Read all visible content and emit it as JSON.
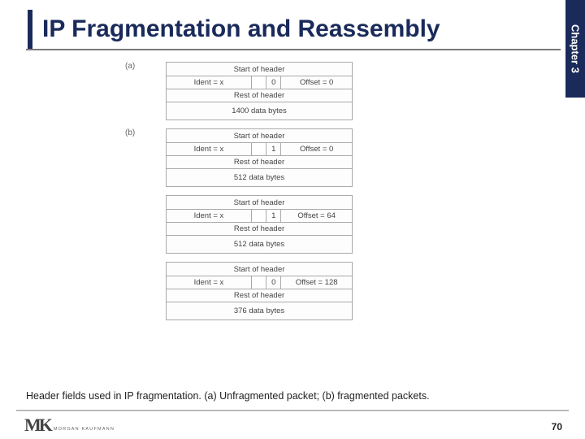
{
  "chapter": "Chapter 3",
  "title": "IP Fragmentation and Reassembly",
  "caption": "Header fields used in IP fragmentation. (a) Unfragmented packet; (b) fragmented packets.",
  "logo_mark": "MK",
  "logo_sub": "MORGAN KAUFMANN",
  "page_num": "70",
  "labels": {
    "a": "(a)",
    "b": "(b)"
  },
  "common": {
    "start_header": "Start of header",
    "rest_header": "Rest of header",
    "ident": "Ident = x"
  },
  "packets": [
    {
      "flag": "0",
      "offset": "Offset = 0",
      "data": "1400 data bytes"
    },
    {
      "flag": "1",
      "offset": "Offset = 0",
      "data": "512 data bytes"
    },
    {
      "flag": "1",
      "offset": "Offset = 64",
      "data": "512 data bytes"
    },
    {
      "flag": "0",
      "offset": "Offset = 128",
      "data": "376 data bytes"
    }
  ]
}
